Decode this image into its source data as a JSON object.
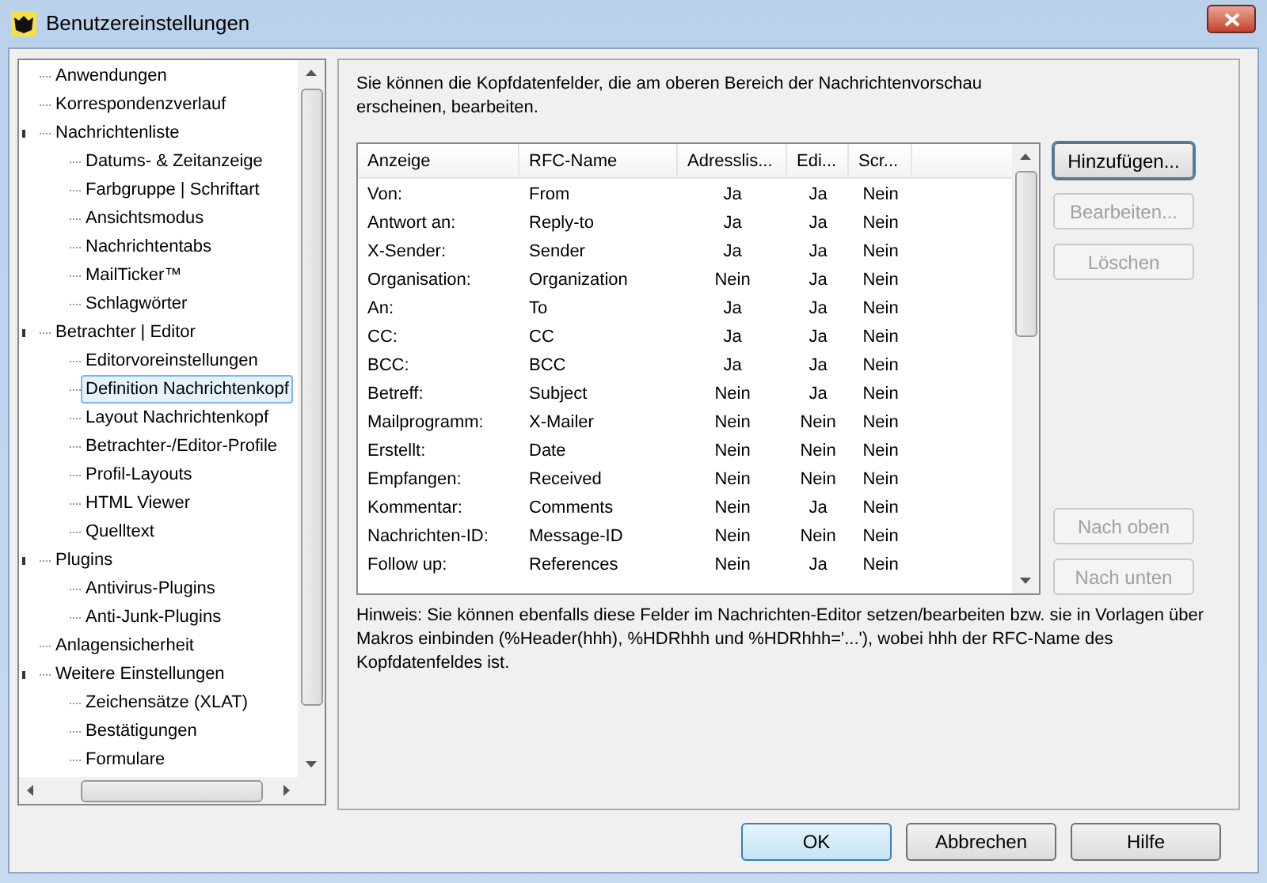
{
  "window": {
    "title": "Benutzereinstellungen"
  },
  "tree": {
    "items": [
      {
        "label": "Anwendungen",
        "selected": false
      },
      {
        "label": "Korrespondenzverlauf",
        "selected": false
      },
      {
        "label": "Nachrichtenliste",
        "selected": false,
        "expanded": true,
        "children": [
          {
            "label": "Datums- & Zeitanzeige",
            "selected": false
          },
          {
            "label": "Farbgruppe | Schriftart",
            "selected": false
          },
          {
            "label": "Ansichtsmodus",
            "selected": false
          },
          {
            "label": "Nachrichtentabs",
            "selected": false
          },
          {
            "label": "MailTicker™",
            "selected": false
          },
          {
            "label": "Schlagwörter",
            "selected": false
          }
        ]
      },
      {
        "label": "Betrachter | Editor",
        "selected": false,
        "expanded": true,
        "children": [
          {
            "label": "Editorvoreinstellungen",
            "selected": false
          },
          {
            "label": "Definition Nachrichtenkopf",
            "selected": true
          },
          {
            "label": "Layout Nachrichtenkopf",
            "selected": false
          },
          {
            "label": "Betrachter-/Editor-Profile",
            "selected": false
          },
          {
            "label": "Profil-Layouts",
            "selected": false
          },
          {
            "label": "HTML Viewer",
            "selected": false
          },
          {
            "label": "Quelltext",
            "selected": false
          }
        ]
      },
      {
        "label": "Plugins",
        "selected": false,
        "expanded": true,
        "children": [
          {
            "label": "Antivirus-Plugins",
            "selected": false
          },
          {
            "label": "Anti-Junk-Plugins",
            "selected": false
          }
        ]
      },
      {
        "label": "Anlagensicherheit",
        "selected": false
      },
      {
        "label": "Weitere Einstellungen",
        "selected": false,
        "expanded": true,
        "children": [
          {
            "label": "Zeichensätze (XLAT)",
            "selected": false
          },
          {
            "label": "Bestätigungen",
            "selected": false
          },
          {
            "label": "Formulare",
            "selected": false
          }
        ]
      }
    ]
  },
  "panel": {
    "intro": "Sie können die Kopfdatenfelder, die am oberen Bereich der Nachrichtenvorschau erscheinen, bearbeiten.",
    "table": {
      "columns": [
        "Anzeige",
        "RFC-Name",
        "Adresslis...",
        "Edi...",
        "Scr..."
      ],
      "rows": [
        [
          "Von:",
          "From",
          "Ja",
          "Ja",
          "Nein"
        ],
        [
          "Antwort an:",
          "Reply-to",
          "Ja",
          "Ja",
          "Nein"
        ],
        [
          "X-Sender:",
          "Sender",
          "Ja",
          "Ja",
          "Nein"
        ],
        [
          "Organisation:",
          "Organization",
          "Nein",
          "Ja",
          "Nein"
        ],
        [
          "An:",
          "To",
          "Ja",
          "Ja",
          "Nein"
        ],
        [
          "CC:",
          "CC",
          "Ja",
          "Ja",
          "Nein"
        ],
        [
          "BCC:",
          "BCC",
          "Ja",
          "Ja",
          "Nein"
        ],
        [
          "Betreff:",
          "Subject",
          "Nein",
          "Ja",
          "Nein"
        ],
        [
          "Mailprogramm:",
          "X-Mailer",
          "Nein",
          "Nein",
          "Nein"
        ],
        [
          "Erstellt:",
          "Date",
          "Nein",
          "Nein",
          "Nein"
        ],
        [
          "Empfangen:",
          "Received",
          "Nein",
          "Nein",
          "Nein"
        ],
        [
          "Kommentar:",
          "Comments",
          "Nein",
          "Ja",
          "Nein"
        ],
        [
          "Nachrichten-ID:",
          "Message-ID",
          "Nein",
          "Nein",
          "Nein"
        ],
        [
          "Follow up:",
          "References",
          "Nein",
          "Ja",
          "Nein"
        ]
      ]
    },
    "actions": [
      {
        "label": "Hinzufügen...",
        "disabled": false
      },
      {
        "label": "Bearbeiten...",
        "disabled": true
      },
      {
        "label": "Löschen",
        "disabled": true
      }
    ],
    "move_buttons": [
      {
        "label": "Nach oben",
        "disabled": true
      },
      {
        "label": "Nach unten",
        "disabled": true
      }
    ],
    "hint": "Hinweis: Sie können ebenfalls diese Felder im Nachrichten-Editor setzen/bearbeiten bzw. sie in Vorlagen über Makros einbinden (%Header(hhh), %HDRhhh und %HDRhhh='...'), wobei hhh der RFC-Name des Kopfdatenfeldes ist."
  },
  "footer_buttons": [
    {
      "label": "OK",
      "default": true
    },
    {
      "label": "Abbrechen",
      "default": false
    },
    {
      "label": "Hilfe",
      "default": false
    }
  ]
}
